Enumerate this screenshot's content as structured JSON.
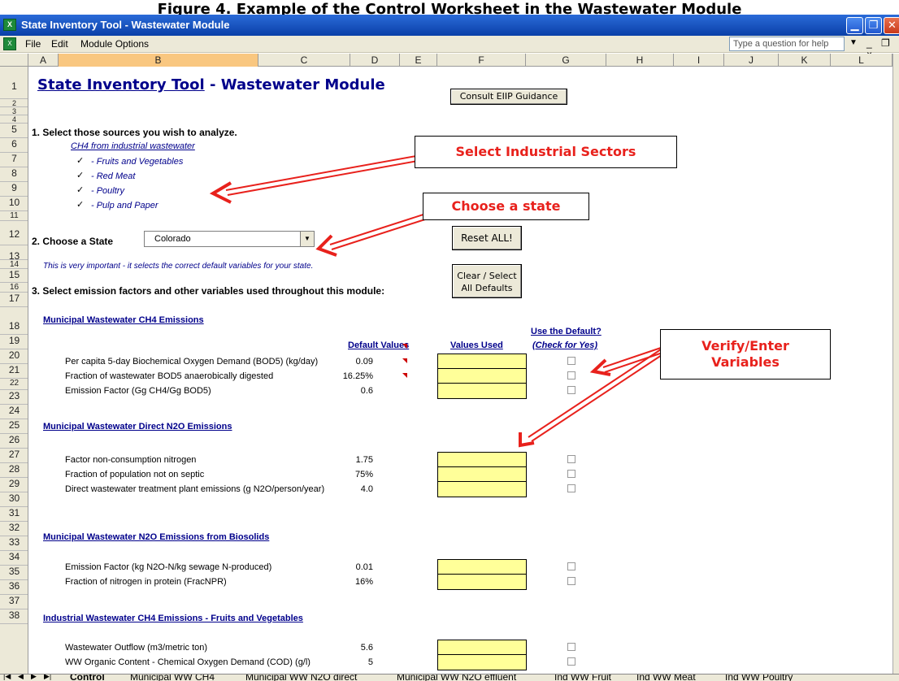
{
  "figure_title": "Figure 4. Example of the Control Worksheet in the Wastewater Module",
  "window": {
    "title": "State Inventory Tool - Wastewater Module",
    "app_icon": "excel-icon"
  },
  "menu": {
    "items": [
      "File",
      "Edit",
      "Module Options"
    ],
    "help_placeholder": "Type a question for help"
  },
  "columns": [
    "A",
    "B",
    "C",
    "D",
    "E",
    "F",
    "G",
    "H",
    "I",
    "J",
    "K",
    "L"
  ],
  "rows": [
    "1",
    "2",
    "3",
    "4",
    "5",
    "6",
    "7",
    "8",
    "9",
    "10",
    "11",
    "12",
    "13",
    "14",
    "15",
    "16",
    "17",
    "18",
    "19",
    "20",
    "21",
    "22",
    "23",
    "24",
    "25",
    "26",
    "27",
    "28",
    "29",
    "30",
    "31",
    "32",
    "33",
    "34",
    "35",
    "36",
    "37",
    "38"
  ],
  "sheet": {
    "title_part1": "State Inventory Tool",
    "title_sep": "-",
    "title_part2": "Wastewater Module",
    "consult_button": "Consult EIIP Guidance",
    "section1": "1. Select those sources you wish to analyze.",
    "ch4_industrial": "CH4 from industrial wastewater",
    "sources": [
      {
        "label": "- Fruits and Vegetables",
        "checked": true
      },
      {
        "label": "- Red Meat",
        "checked": true
      },
      {
        "label": "- Poultry",
        "checked": true
      },
      {
        "label": "- Pulp and Paper",
        "checked": true
      }
    ],
    "section2": "2. Choose a State",
    "state_value": "Colorado",
    "state_note": "This is very important - it selects the correct default variables for your state.",
    "reset_button": "Reset ALL!",
    "clear_button_line1": "Clear / Select",
    "clear_button_line2": "All Defaults",
    "section3": "3. Select emission factors and other variables used throughout this module:",
    "default_values_header": "Default Values",
    "values_used_header": "Values Used",
    "use_default_header1": "Use the Default?",
    "use_default_header2": "(Check for Yes)",
    "groups": [
      {
        "title": "Municipal Wastewater CH4 Emissions",
        "items": [
          {
            "label": "Per capita 5-day Biochemical Oxygen Demand (BOD5) (kg/day)",
            "default": "0.09"
          },
          {
            "label": "Fraction of wastewater BOD5 anaerobically digested",
            "default": "16.25%"
          },
          {
            "label": "Emission Factor (Gg CH4/Gg BOD5)",
            "default": "0.6"
          }
        ]
      },
      {
        "title": "Municipal Wastewater Direct N2O Emissions",
        "items": [
          {
            "label": "Factor non-consumption nitrogen",
            "default": "1.75"
          },
          {
            "label": "Fraction of population not on septic",
            "default": "75%"
          },
          {
            "label": "Direct wastewater treatment plant emissions (g N2O/person/year)",
            "default": "4.0"
          }
        ]
      },
      {
        "title": "Municipal Wastewater N2O Emissions from Biosolids",
        "items": [
          {
            "label": "Emission Factor (kg N2O-N/kg sewage N-produced)",
            "default": "0.01"
          },
          {
            "label": "Fraction of nitrogen in protein (FracNPR)",
            "default": "16%"
          }
        ]
      },
      {
        "title": "Industrial Wastewater CH4 Emissions - Fruits and Vegetables",
        "items": [
          {
            "label": "Wastewater Outflow (m3/metric ton)",
            "default": "5.6"
          },
          {
            "label": "WW Organic Content - Chemical Oxygen Demand (COD) (g/l)",
            "default": "5"
          }
        ]
      }
    ]
  },
  "callouts": {
    "industrial": "Select Industrial Sectors",
    "state": "Choose a state",
    "verify_line1": "Verify/Enter",
    "verify_line2": "Variables"
  },
  "tabs": [
    "Control",
    "Municipal WW CH4",
    "Municipal WW N2O direct",
    "Municipal WW N2O effluent",
    "Ind WW Fruit",
    "Ind WW Meat",
    "Ind WW Poultry"
  ],
  "colors": {
    "accent": "#00008b",
    "input_fill": "#ffff99",
    "callout_text": "#e8211c",
    "selected_col": "#f9c780"
  }
}
